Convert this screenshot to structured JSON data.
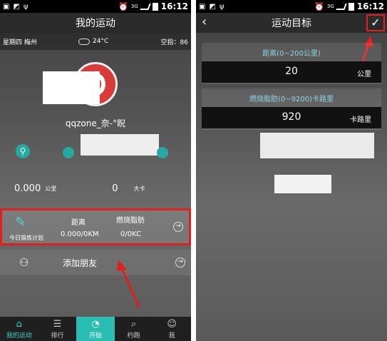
{
  "status": {
    "time": "16:12",
    "network": "3G"
  },
  "left": {
    "title": "我的运动",
    "weather": {
      "day": "星期四",
      "city": "梅州",
      "temp": "24°C",
      "aqi": "空指：86"
    },
    "username": "qqzone_奈-°眖",
    "stats": {
      "distance": "0.000",
      "distance_unit": "公里",
      "calories": "0",
      "calories_unit": "大卡"
    },
    "goal": {
      "plan_label": "今日锻炼计划",
      "distance_header": "距离",
      "fat_header": "燃烧脂肪",
      "distance_value": "0.000/0KM",
      "fat_value": "0/0KC"
    },
    "friends_label": "添加朋友",
    "tabs": [
      {
        "label": "我的运动",
        "icon": "home-icon"
      },
      {
        "label": "排行",
        "icon": "list-icon"
      },
      {
        "label": "开始",
        "icon": "timer-icon"
      },
      {
        "label": "约跑",
        "icon": "search-icon"
      },
      {
        "label": "我",
        "icon": "user-icon"
      }
    ]
  },
  "right": {
    "title": "运动目标",
    "distance_label": "距离(0~200公里)",
    "distance_value": "20",
    "distance_unit": "公里",
    "fat_label": "燃烧脂肪(0~9200)卡路里",
    "fat_value": "920",
    "fat_unit": "卡路里"
  },
  "colors": {
    "accent": "#2abdb3",
    "highlight": "#e02020"
  }
}
